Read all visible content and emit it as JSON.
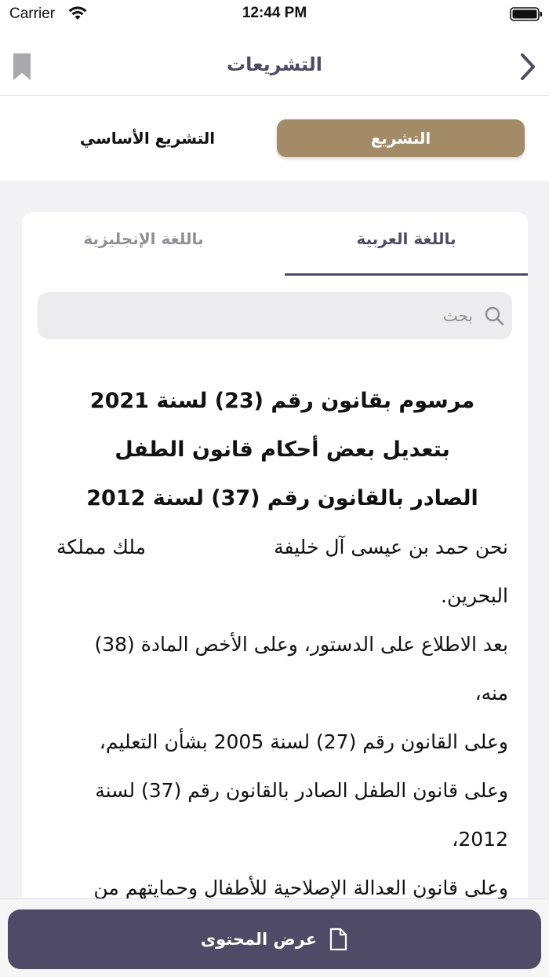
{
  "status_bar": {
    "carrier": "Carrier",
    "time": "12:44 PM"
  },
  "nav": {
    "title": "التشريعات",
    "icons": [
      "bookmark-icon",
      "chevron-right-icon"
    ]
  },
  "type_toggle": {
    "active": "التشريع",
    "inactive": "التشريع الأساسي"
  },
  "language_tabs": {
    "arabic": "باللغة العربية",
    "english": "باللغة الإنجليزية",
    "selected": "arabic"
  },
  "search": {
    "placeholder": "بحث",
    "value": ""
  },
  "document": {
    "title_lines": [
      "مرسوم بقانون رقم (23) لسنة 2021",
      "بتعديل بعض أحكام قانون الطفل",
      "الصادر بالقانون رقم (37) لسنة 2012"
    ],
    "intro_name": "نحن حمد بن عيسى آل خليفة",
    "intro_title": "ملك مملكة",
    "intro_country": "البحرين.",
    "paragraphs": [
      "بعد الاطلاع على الدستور، وعلى الأخص المادة (38) منه،",
      "وعلى القانون رقم (27) لسنة 2005 بشأن التعليم،",
      "وعلى قانون الطفل الصادر بالقانون رقم (37) لسنة 2012،",
      "وعلى قانون العدالة الإصلاحية للأطفال وحمايتهم من"
    ]
  },
  "bottom_button": {
    "label": "عرض المحتوى",
    "icon": "file-icon"
  },
  "colors": {
    "brand_purple": "#4f4a66",
    "accent_gold": "#a48b67",
    "background": "#f2f2f4"
  }
}
